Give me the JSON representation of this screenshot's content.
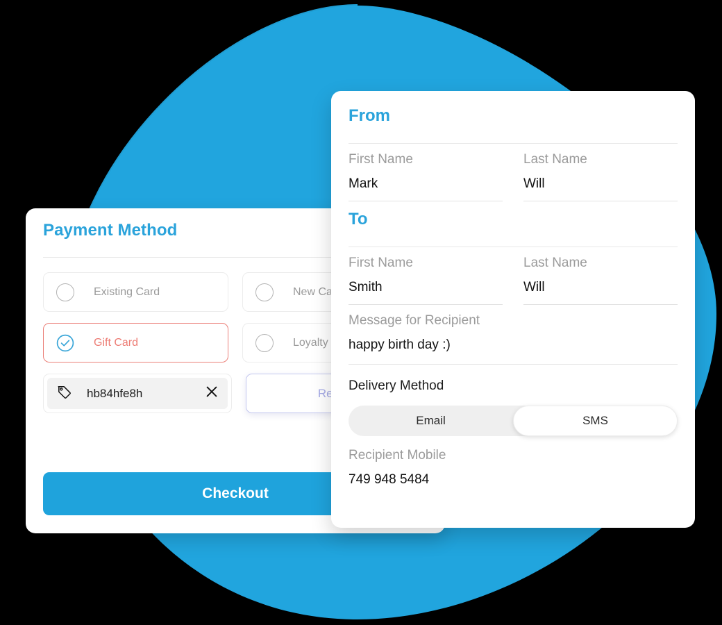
{
  "theme": {
    "brand_blue": "#1fa3dc",
    "heading_blue": "#2aa3db",
    "selected_red": "#ed7c74",
    "redeem_purple": "#a6abe6",
    "blob_blue": "#21a5de"
  },
  "payment_card": {
    "title": "Payment Method",
    "options": [
      {
        "label": "Existing Card",
        "selected": false,
        "icon": "radio-icon"
      },
      {
        "label": "New Card",
        "selected": false,
        "icon": "radio-icon"
      },
      {
        "label": "Gift Card",
        "selected": true,
        "icon": "check-circle-icon"
      },
      {
        "label": "Loyalty Points",
        "selected": false,
        "icon": "radio-icon"
      }
    ],
    "code_field": {
      "icon": "tag-icon",
      "value": "hb84hfe8h",
      "clear_icon": "close-icon"
    },
    "redeem_label": "Redeem",
    "checkout_label": "Checkout"
  },
  "gift_card": {
    "from_heading": "From",
    "to_heading": "To",
    "from": {
      "first_name_label": "First Name",
      "first_name_value": "Mark",
      "last_name_label": "Last Name",
      "last_name_value": "Will"
    },
    "to": {
      "first_name_label": "First Name",
      "first_name_value": "Smith",
      "last_name_label": "Last Name",
      "last_name_value": "Will"
    },
    "message": {
      "label": "Message for Recipient",
      "value": "happy birth day :)"
    },
    "delivery": {
      "label": "Delivery Method",
      "options": [
        {
          "label": "Email",
          "active": false
        },
        {
          "label": "SMS",
          "active": true
        }
      ]
    },
    "mobile": {
      "label": "Recipient Mobile",
      "value": "749 948 5484"
    }
  }
}
